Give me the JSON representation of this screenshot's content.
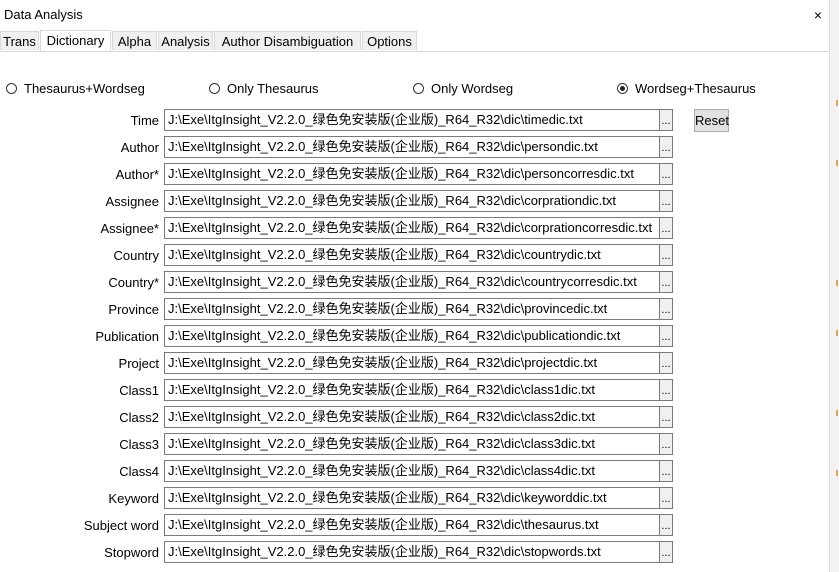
{
  "window": {
    "title": "Data Analysis",
    "close_glyph": "×"
  },
  "tabs": [
    {
      "label": "Trans"
    },
    {
      "label": "Dictionary",
      "active": true
    },
    {
      "label": "Alpha"
    },
    {
      "label": "Analysis"
    },
    {
      "label": "Author Disambiguation"
    },
    {
      "label": "Options"
    }
  ],
  "mode_options": [
    {
      "label": "Thesaurus+Wordseg",
      "checked": false
    },
    {
      "label": "Only Thesaurus",
      "checked": false
    },
    {
      "label": "Only Wordseg",
      "checked": false
    },
    {
      "label": "Wordseg+Thesaurus",
      "checked": true
    }
  ],
  "reset_label": "Reset",
  "browse_label": "...",
  "dictionaries": [
    {
      "label": "Time",
      "path": "J:\\Exe\\ItgInsight_V2.2.0_绿色免安装版(企业版)_R64_R32\\dic\\timedic.txt"
    },
    {
      "label": "Author",
      "path": "J:\\Exe\\ItgInsight_V2.2.0_绿色免安装版(企业版)_R64_R32\\dic\\persondic.txt"
    },
    {
      "label": "Author*",
      "path": "J:\\Exe\\ItgInsight_V2.2.0_绿色免安装版(企业版)_R64_R32\\dic\\personcorresdic.txt"
    },
    {
      "label": "Assignee",
      "path": "J:\\Exe\\ItgInsight_V2.2.0_绿色免安装版(企业版)_R64_R32\\dic\\corprationdic.txt"
    },
    {
      "label": "Assignee*",
      "path": "J:\\Exe\\ItgInsight_V2.2.0_绿色免安装版(企业版)_R64_R32\\dic\\corprationcorresdic.txt"
    },
    {
      "label": "Country",
      "path": "J:\\Exe\\ItgInsight_V2.2.0_绿色免安装版(企业版)_R64_R32\\dic\\countrydic.txt"
    },
    {
      "label": "Country*",
      "path": "J:\\Exe\\ItgInsight_V2.2.0_绿色免安装版(企业版)_R64_R32\\dic\\countrycorresdic.txt"
    },
    {
      "label": "Province",
      "path": "J:\\Exe\\ItgInsight_V2.2.0_绿色免安装版(企业版)_R64_R32\\dic\\provincedic.txt"
    },
    {
      "label": "Publication",
      "path": "J:\\Exe\\ItgInsight_V2.2.0_绿色免安装版(企业版)_R64_R32\\dic\\publicationdic.txt"
    },
    {
      "label": "Project",
      "path": "J:\\Exe\\ItgInsight_V2.2.0_绿色免安装版(企业版)_R64_R32\\dic\\projectdic.txt"
    },
    {
      "label": "Class1",
      "path": "J:\\Exe\\ItgInsight_V2.2.0_绿色免安装版(企业版)_R64_R32\\dic\\class1dic.txt"
    },
    {
      "label": "Class2",
      "path": "J:\\Exe\\ItgInsight_V2.2.0_绿色免安装版(企业版)_R64_R32\\dic\\class2dic.txt"
    },
    {
      "label": "Class3",
      "path": "J:\\Exe\\ItgInsight_V2.2.0_绿色免安装版(企业版)_R64_R32\\dic\\class3dic.txt"
    },
    {
      "label": "Class4",
      "path": "J:\\Exe\\ItgInsight_V2.2.0_绿色免安装版(企业版)_R64_R32\\dic\\class4dic.txt"
    },
    {
      "label": "Keyword",
      "path": "J:\\Exe\\ItgInsight_V2.2.0_绿色免安装版(企业版)_R64_R32\\dic\\keyworddic.txt"
    },
    {
      "label": "Subject word",
      "path": "J:\\Exe\\ItgInsight_V2.2.0_绿色免安装版(企业版)_R64_R32\\dic\\thesaurus.txt"
    },
    {
      "label": "Stopword",
      "path": "J:\\Exe\\ItgInsight_V2.2.0_绿色免安装版(企业版)_R64_R32\\dic\\stopwords.txt"
    }
  ]
}
